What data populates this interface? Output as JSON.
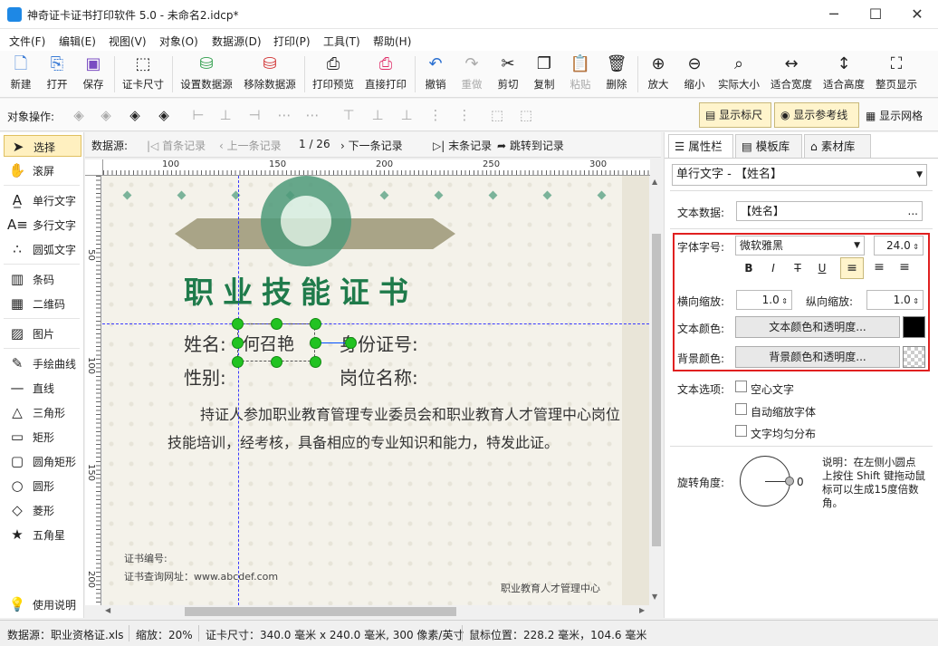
{
  "window": {
    "title": "神奇证卡证书打印软件 5.0 - 未命名2.idcp*",
    "minimize": "─",
    "maximize": "☐",
    "close": "✕"
  },
  "menu": [
    "文件(F)",
    "编辑(E)",
    "视图(V)",
    "对象(O)",
    "数据源(D)",
    "打印(P)",
    "工具(T)",
    "帮助(H)"
  ],
  "toolbar": {
    "new": "新建",
    "open": "打开",
    "save": "保存",
    "card_size": "证卡尺寸",
    "set_ds": "设置数据源",
    "remove_ds": "移除数据源",
    "print_preview": "打印预览",
    "direct_print": "直接打印",
    "undo": "撤销",
    "redo": "重做",
    "cut": "剪切",
    "copy": "复制",
    "paste": "粘贴",
    "delete": "删除",
    "zoom_in": "放大",
    "zoom_out": "缩小",
    "actual_size": "实际大小",
    "fit_width": "适合宽度",
    "fit_height": "适合高度",
    "fit_page": "整页显示"
  },
  "toolbar2": {
    "label": "对象操作:",
    "show_ruler": "显示标尺",
    "show_guides": "显示参考线",
    "show_grid": "显示网格"
  },
  "tools": {
    "select": "选择",
    "scroll": "滚屏",
    "single_text": "单行文字",
    "multi_text": "多行文字",
    "arc_text": "圆弧文字",
    "barcode": "条码",
    "qrcode": "二维码",
    "image": "图片",
    "freehand": "手绘曲线",
    "line": "直线",
    "triangle": "三角形",
    "rect": "矩形",
    "round_rect": "圆角矩形",
    "circle": "圆形",
    "diamond": "菱形",
    "star": "五角星",
    "help": "使用说明"
  },
  "records": {
    "label": "数据源:",
    "first": "首条记录",
    "prev": "上一条记录",
    "position": "1 / 26",
    "next": "下一条记录",
    "last": "末条记录",
    "goto": "跳转到记录"
  },
  "ruler": {
    "h": [
      "100",
      "150",
      "200",
      "250",
      "300"
    ],
    "v": [
      "50",
      "100",
      "150",
      "200"
    ]
  },
  "certificate": {
    "title": "职业技能证书",
    "name_label": "姓名:",
    "name_value": "何召艳",
    "id_label": "身份证号:",
    "gender_label": "性别:",
    "position_label": "岗位名称:",
    "paragraph": "持证人参加职业教育管理专业委员会和职业教育人才管理中心岗位技能培训，经考核，具备相应的专业知识和能力，特发此证。",
    "cert_no": "证书编号:",
    "query_url": "证书查询网址：www.abcdef.com",
    "issuer": "职业教育人才管理中心"
  },
  "panel": {
    "tabs": [
      "属性栏",
      "模板库",
      "素材库"
    ],
    "object_select": "单行文字 - 【姓名】",
    "text_data_label": "文本数据:",
    "text_data_value": "【姓名】",
    "text_data_btn": "...",
    "font_label": "字体字号:",
    "font_name": "微软雅黑",
    "font_size": "24.0",
    "style_btns": [
      "B",
      "I",
      "T",
      "U"
    ],
    "hscale_label": "横向缩放:",
    "hscale": "1.0",
    "vscale_label": "纵向缩放:",
    "vscale": "1.0",
    "text_color_label": "文本颜色:",
    "text_color_btn": "文本颜色和透明度...",
    "text_color": "#000000",
    "bg_color_label": "背景颜色:",
    "bg_color_btn": "背景颜色和透明度...",
    "options_label": "文本选项:",
    "opt_hollow": "空心文字",
    "opt_autoscale": "自动缩放字体",
    "opt_distribute": "文字均匀分布",
    "rotation_label": "旋转角度:",
    "rotation_value": "0",
    "hint": "说明：在左侧小圆点上按住 Shift 键拖动鼠标可以生成15度倍数角。"
  },
  "status": {
    "datasource": "数据源：职业资格证.xls",
    "zoom": "缩放：20%",
    "card_size": "证卡尺寸：340.0 毫米 x 240.0 毫米, 300 像素/英寸",
    "mouse": "鼠标位置：228.2 毫米，104.6 毫米"
  }
}
